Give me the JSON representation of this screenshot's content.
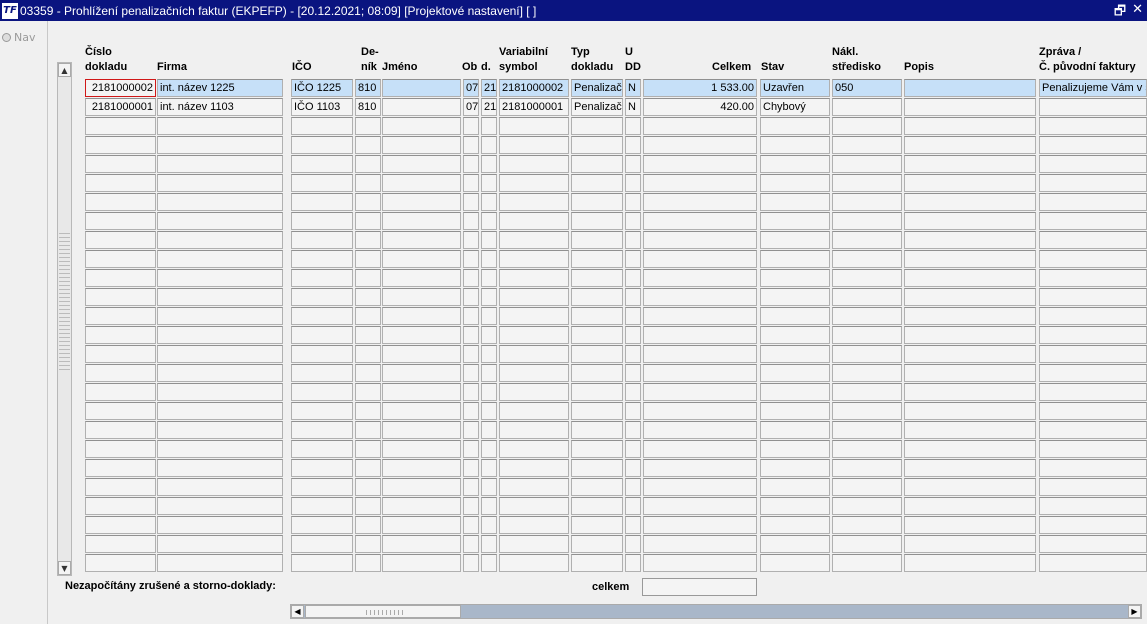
{
  "window": {
    "title": "03359 - Prohlížení penalizačních faktur (EKPEFP) - [20.12.2021; 08:09]  [Projektové nastavení]  [ ]",
    "app_icon": "TF"
  },
  "nav": {
    "label": "Nav"
  },
  "columns": {
    "cislo": "Číslo\ndokladu",
    "firma": "Firma",
    "ico": "IČO",
    "denik": "De-\nník",
    "jmeno": "Jméno",
    "ob": "Ob",
    "d": "d.",
    "vs": "Variabilní\nsymbol",
    "typ": "Typ\ndokladu",
    "udd": "U\nDD",
    "celkem": "Celkem",
    "stav": "Stav",
    "nakl": "Nákl.\nstředisko",
    "popis": "Popis",
    "zprava": "Zpráva /\nČ. původní faktury"
  },
  "rows": [
    {
      "cislo": "2181000002",
      "firma": "int. název 1225",
      "ico": "IČO 1225",
      "denik": "810",
      "jmeno": "",
      "ob": "07",
      "d": "21",
      "vs": "2181000002",
      "typ": "Penalizační",
      "udd": "N",
      "celkem": "1 533.00",
      "stav": "Uzavřen",
      "nakl": "050",
      "popis": "",
      "zprava": "Penalizujeme Vám v souvislosti"
    },
    {
      "cislo": "2181000001",
      "firma": "int. název 1103",
      "ico": "IČO 1103",
      "denik": "810",
      "jmeno": "",
      "ob": "07",
      "d": "21",
      "vs": "2181000001",
      "typ": "Penalizační",
      "udd": "N",
      "celkem": "420.00",
      "stav": "Chybový",
      "nakl": "",
      "popis": "",
      "zprava": ""
    }
  ],
  "footer": {
    "note": "Nezapočítány zrušené a storno-doklady:",
    "celkem_label": "celkem",
    "celkem_value": ""
  }
}
